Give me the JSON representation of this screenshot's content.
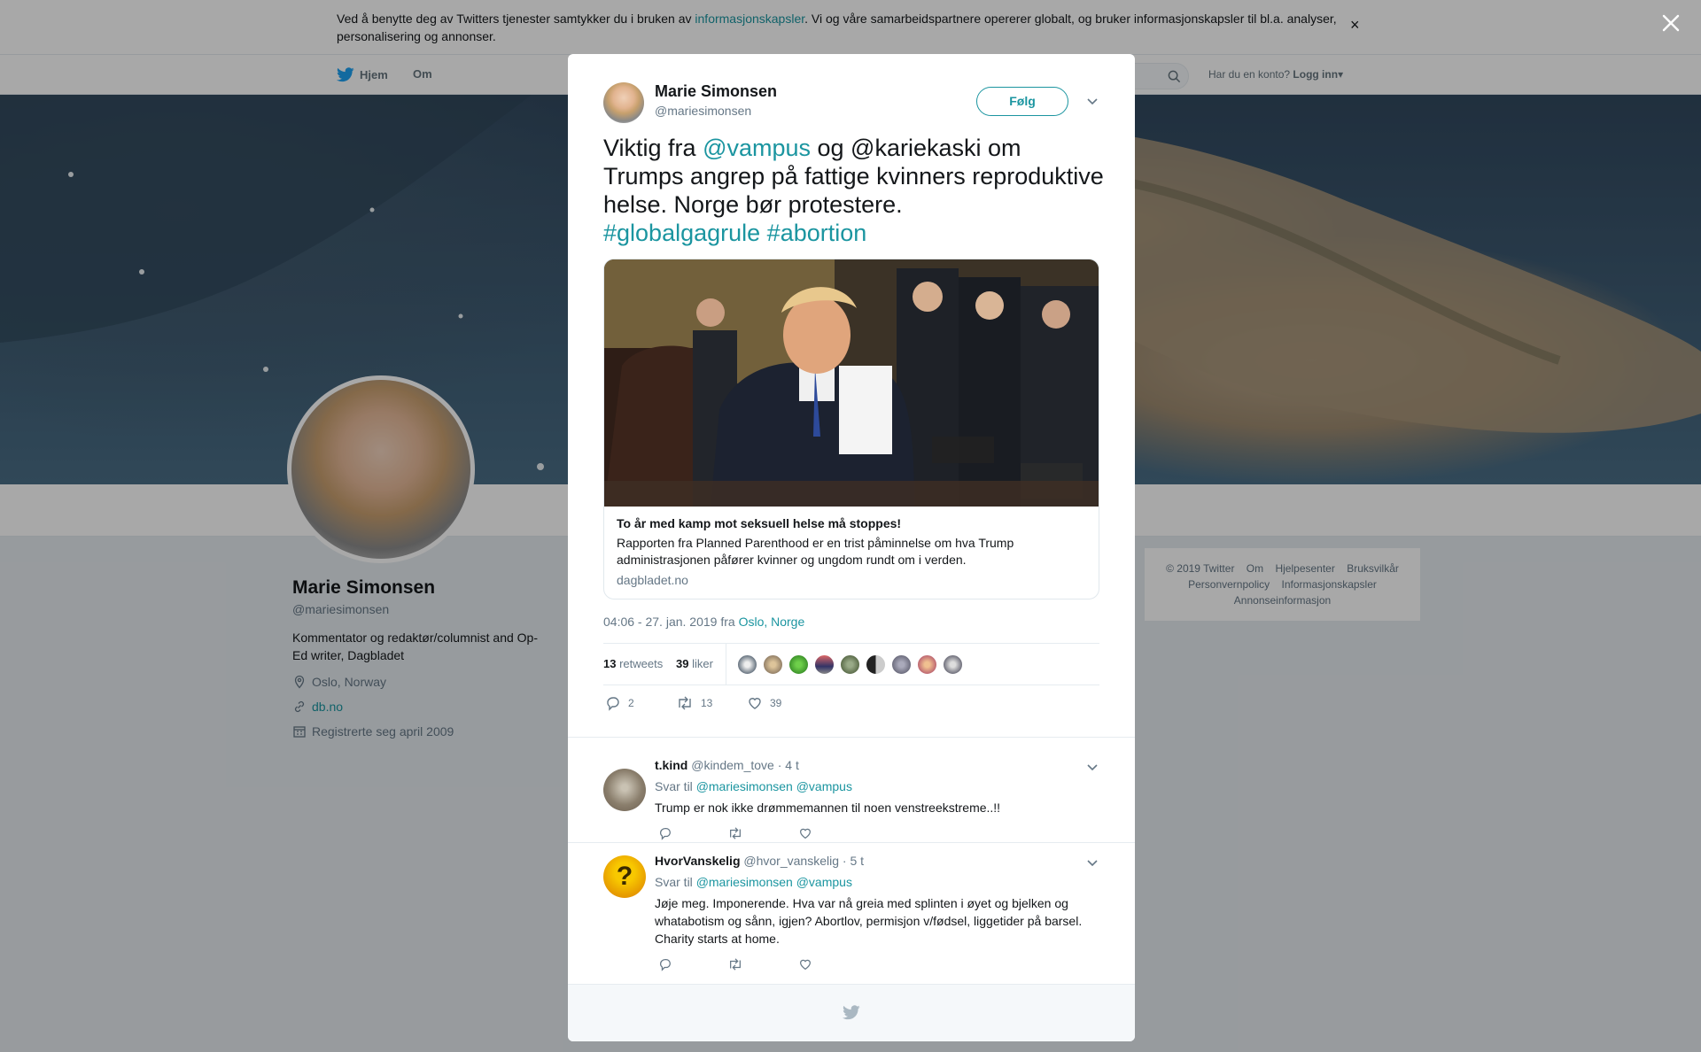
{
  "cookie_bar": {
    "text_before": "Ved å benytte deg av Twitters tjenester samtykker du i bruken av ",
    "link": "informasjonskapsler",
    "text_after": ". Vi og våre samarbeidspartnere opererer globalt, og bruker informasjonskapsler til bl.a. analyser, personalisering og annonser.",
    "close": "×"
  },
  "nav": {
    "home": "Hjem",
    "about": "Om",
    "login_prompt": "Har du en konto?",
    "login": "Logg inn"
  },
  "profile": {
    "name": "Marie Simonsen",
    "handle": "@mariesimonsen",
    "bio": "Kommentator og redaktør/columnist and Op-Ed writer, Dagbladet",
    "location": "Oslo, Norway",
    "website": "db.no",
    "joined": "Registrerte seg april 2009"
  },
  "footer": {
    "links": [
      "© 2019 Twitter",
      "Om",
      "Hjelpesenter",
      "Bruksvilkår",
      "Personvernpolicy",
      "Informasjonskapsler",
      "Annonseinformasjon"
    ]
  },
  "tweet": {
    "name": "Marie Simonsen",
    "handle": "@mariesimonsen",
    "follow": "Følg",
    "text_1": "Viktig fra ",
    "mention": "@vampus",
    "text_2": " og @kariekaski om Trumps angrep på fattige kvinners reproduktive helse. Norge bør protestere. ",
    "hashtag_1": "#globalgagrule",
    "hashtag_2": "#abortion",
    "card": {
      "title": "To år med kamp mot seksuell helse må stoppes!",
      "description": "Rapporten fra Planned Parenthood er en trist påminnelse om hva Trump administrasjonen påfører kvinner og ungdom rundt om i verden.",
      "domain": "dagbladet.no"
    },
    "timestamp": "04:06 - 27. jan. 2019 fra ",
    "place": "Oslo, Norge",
    "retweets_count": "13",
    "retweets_label": "retweets",
    "likes_count": "39",
    "likes_label": "liker",
    "reply_count": "2",
    "retweet_action_count": "13",
    "like_action_count": "39"
  },
  "replies": [
    {
      "name": "t.kind",
      "handle": "@kindem_tove",
      "time": "· 4 t",
      "reply_to": "Svar til ",
      "reply_to_handles": "@mariesimonsen @vampus",
      "text": "Trump er nok ikke drømmemannen til noen venstreekstreme..!!"
    },
    {
      "name": "HvorVanskelig",
      "handle": "@hvor_vanskelig",
      "time": "· 5 t",
      "reply_to": "Svar til ",
      "reply_to_handles": "@mariesimonsen @vampus",
      "text": "Jøje meg. Imponerende. Hva var nå greia med splinten i øyet og bjelken og whatabotism og sånn, igjen? Abortlov, permisjon v/fødsel, liggetider på barsel. Charity starts at home."
    }
  ],
  "colors": {
    "accent": "#1b95a0",
    "text": "#14171a",
    "muted": "#657786",
    "twitter_blue": "#1da1f2"
  }
}
